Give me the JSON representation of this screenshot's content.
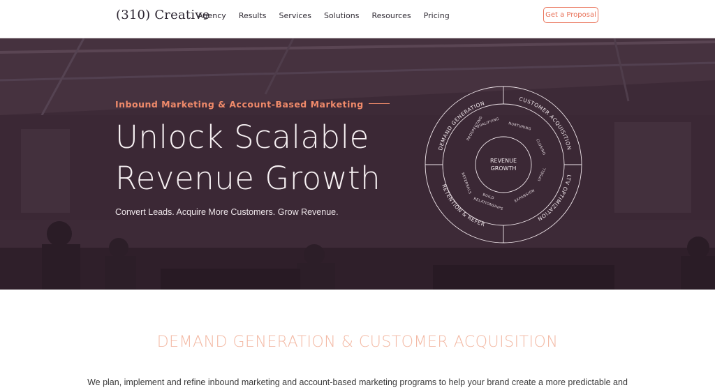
{
  "header": {
    "logo": "(310) Creative",
    "nav": [
      "Agency",
      "Results",
      "Services",
      "Solutions",
      "Resources",
      "Pricing"
    ],
    "cta": "Get a Proposal"
  },
  "hero": {
    "eyebrow": "Inbound Marketing & Account-Based Marketing",
    "title_line1": "Unlock Scalable",
    "title_line2": "Revenue Growth",
    "subtitle": "Convert Leads. Acquire More Customers. Grow Revenue."
  },
  "cycle": {
    "center_line1": "REVENUE",
    "center_line2": "GROWTH",
    "outer": [
      "DEMAND GENERATION",
      "CUSTOMER ACQUISITION",
      "LTV OPTIMIZATION",
      "RETENTION & REFERRAL"
    ],
    "inner": [
      "QUALIFYING",
      "NURTURING",
      "CLOSING",
      "UPSELL",
      "EXPANSION",
      "BUILD",
      "RELATIONSHIPS",
      "REFERRALS",
      "PROSPECTING"
    ]
  },
  "section": {
    "title": "DEMAND GENERATION & CUSTOMER ACQUISITION",
    "body": "We plan, implement and refine inbound marketing and account-based marketing programs to help your brand create a more predictable and"
  },
  "colors": {
    "accent": "#e9735a",
    "hero_overlay": "#3e2a38",
    "section_title": "#f3b9a4"
  }
}
